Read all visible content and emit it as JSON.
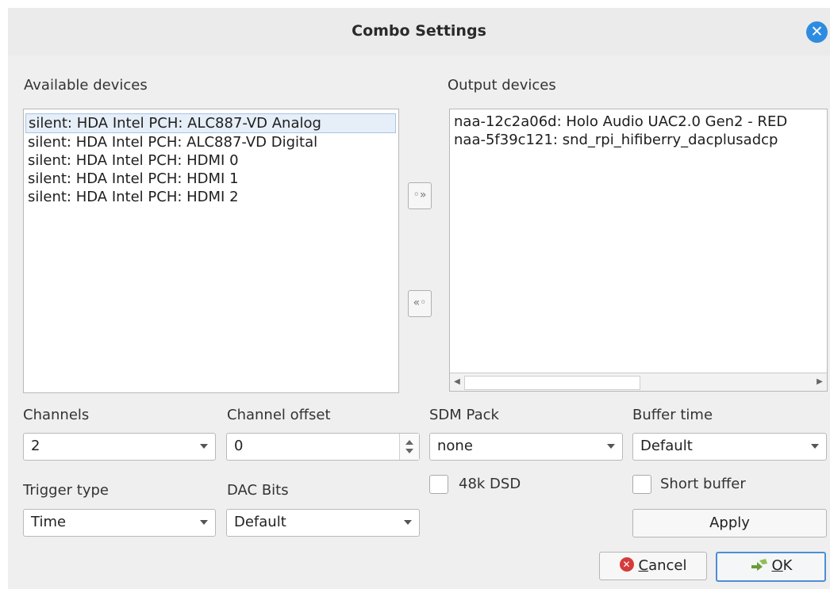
{
  "dialog": {
    "title": "Combo Settings"
  },
  "available": {
    "label": "Available devices",
    "items": [
      "silent: HDA Intel PCH: ALC887-VD Analog",
      "silent: HDA Intel PCH: ALC887-VD Digital",
      "silent: HDA Intel PCH: HDMI 0",
      "silent: HDA Intel PCH: HDMI 1",
      "silent: HDA Intel PCH: HDMI 2"
    ],
    "selected_index": 0
  },
  "output": {
    "label": "Output devices",
    "items": [
      "naa-12c2a06d: Holo Audio UAC2.0 Gen2 - RED",
      "naa-5f39c121: snd_rpi_hifiberry_dacplusadcp"
    ]
  },
  "fields": {
    "channels": {
      "label": "Channels",
      "value": "2"
    },
    "channel_offset": {
      "label": "Channel offset",
      "value": "0"
    },
    "sdm_pack": {
      "label": "SDM Pack",
      "value": "none"
    },
    "buffer_time": {
      "label": "Buffer time",
      "value": "Default"
    },
    "trigger_type": {
      "label": "Trigger type",
      "value": "Time"
    },
    "dac_bits": {
      "label": "DAC Bits",
      "value": "Default"
    },
    "dsd48k": {
      "label": "48k DSD",
      "checked": false
    },
    "short_buffer": {
      "label": "Short buffer",
      "checked": false
    }
  },
  "buttons": {
    "apply": "Apply",
    "cancel_prefix": "",
    "cancel_accel": "C",
    "cancel_rest": "ancel",
    "ok_accel": "O",
    "ok_rest": "K"
  },
  "icons": {
    "close": "close-icon",
    "add": "double-chevron-right-icon",
    "remove": "double-chevron-left-icon",
    "cancel": "cancel-icon",
    "ok": "ok-icon"
  },
  "colors": {
    "accent": "#2d8ce0",
    "selection": "#e6eef8",
    "cancel_red": "#d63b3b"
  }
}
